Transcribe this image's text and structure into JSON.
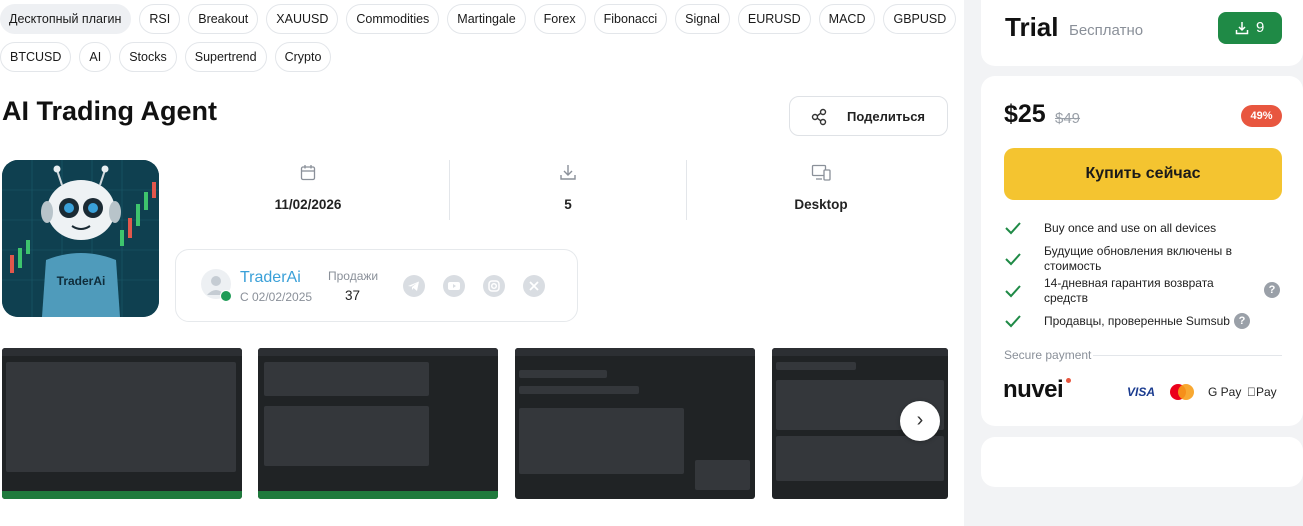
{
  "tags_row1": [
    "Десктопный плагин",
    "RSI",
    "Breakout",
    "XAUUSD",
    "Commodities",
    "Martingale",
    "Forex",
    "Fibonacci",
    "Signal",
    "EURUSD",
    "MACD",
    "GBPUSD"
  ],
  "tags_row2": [
    "BTCUSD",
    "AI",
    "Stocks",
    "Supertrend",
    "Crypto"
  ],
  "product": {
    "title": "AI Trading Agent",
    "share_label": "Поделиться",
    "image_text": "TraderAi"
  },
  "stats": {
    "date": "11/02/2026",
    "downloads": "5",
    "platform": "Desktop"
  },
  "seller": {
    "name": "TraderAi",
    "since": "С 02/02/2025",
    "sales_label": "Продажи",
    "sales_value": "37"
  },
  "sidebar": {
    "trial_title": "Trial",
    "trial_subtitle": "Бесплатно",
    "trial_downloads": "9",
    "price": "$25",
    "old_price": "$49",
    "discount": "49%",
    "buy_label": "Купить сейчас",
    "features": [
      "Buy once and use on all devices",
      "Будущие обновления включены в стоимость",
      "14-дневная гарантия возврата средств",
      "Продавцы, проверенные Sumsub"
    ],
    "secure_label": "Secure payment",
    "payment_brand": "nuvei",
    "payment_methods": [
      "VISA",
      "G Pay",
      "Pay"
    ]
  },
  "colors": {
    "accent_green": "#1f8a46",
    "buy_yellow": "#f4c430",
    "discount_red": "#e8563f",
    "link_blue": "#3aa0d8"
  }
}
